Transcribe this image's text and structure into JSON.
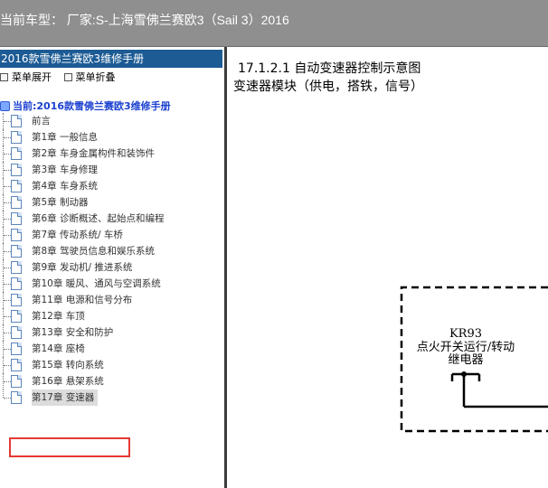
{
  "topbar": {
    "title": "当前车型：  厂家:S-上海雪佛兰赛欧3（Sail 3）2016"
  },
  "sidebar": {
    "header": "2016款雪佛兰赛欧3维修手册",
    "actions": [
      "菜单展开",
      "菜单折叠"
    ],
    "root": "当前:2016款雪佛兰赛欧3维修手册",
    "items": [
      "前言",
      "第1章 一般信息",
      "第2章 车身金属构件和装饰件",
      "第3章 车身修理",
      "第4章 车身系统",
      "第5章 制动器",
      "第6章 诊断概述、起始点和编程",
      "第7章 传动系统/ 车桥",
      "第8章 驾驶员信息和娱乐系统",
      "第9章 发动机/ 推进系统",
      "第10章 暖风、通风与空调系统",
      "第11章 电源和信号分布",
      "第12章 车顶",
      "第13章 安全和防护",
      "第14章 座椅",
      "第15章 转向系统",
      "第16章 悬架系统",
      "第17章 变速器"
    ],
    "selected_index": 17
  },
  "content": {
    "heading": "17.1.2.1 自动变速器控制示意图",
    "subheading": "变速器模块（供电，搭铁，信号）",
    "diagram": {
      "component_id": "KR93",
      "component_name_line1": "点火开关运行/转动",
      "component_name_line2": "继电器"
    }
  },
  "colors": {
    "topbar": "#8f8f8f",
    "sidebar_header": "#1c5b94",
    "highlight": "#e53935"
  }
}
